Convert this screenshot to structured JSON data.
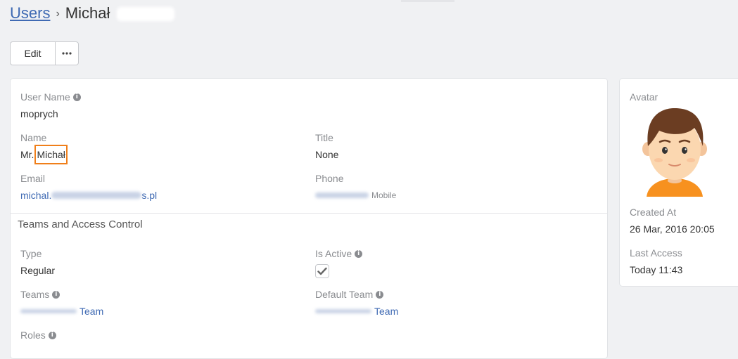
{
  "breadcrumb": {
    "parent": "Users",
    "separator": "›",
    "current": "Michał"
  },
  "toolbar": {
    "edit_label": "Edit",
    "more_label": "•••"
  },
  "overview": {
    "user_name": {
      "label": "User Name",
      "value": "moprych"
    },
    "name": {
      "label": "Name",
      "salutation": "Mr.",
      "first_name": "Michał"
    },
    "title": {
      "label": "Title",
      "value": "None"
    },
    "email": {
      "label": "Email",
      "value_start": "michal.",
      "value_end": "s.pl"
    },
    "phone": {
      "label": "Phone",
      "type": "Mobile"
    }
  },
  "teams_section": {
    "heading": "Teams and Access Control",
    "type": {
      "label": "Type",
      "value": "Regular"
    },
    "is_active": {
      "label": "Is Active",
      "checked": true
    },
    "teams": {
      "label": "Teams",
      "value": "Team"
    },
    "default_team": {
      "label": "Default Team",
      "value": "Team"
    },
    "roles": {
      "label": "Roles"
    }
  },
  "side": {
    "avatar_label": "Avatar",
    "created_at": {
      "label": "Created At",
      "value": "26 Mar, 2016 20:05"
    },
    "last_access": {
      "label": "Last Access",
      "value": "Today 11:43"
    }
  },
  "colors": {
    "link": "#3f6ab3",
    "highlight": "#f07f1a",
    "background": "#f0f1f3"
  }
}
